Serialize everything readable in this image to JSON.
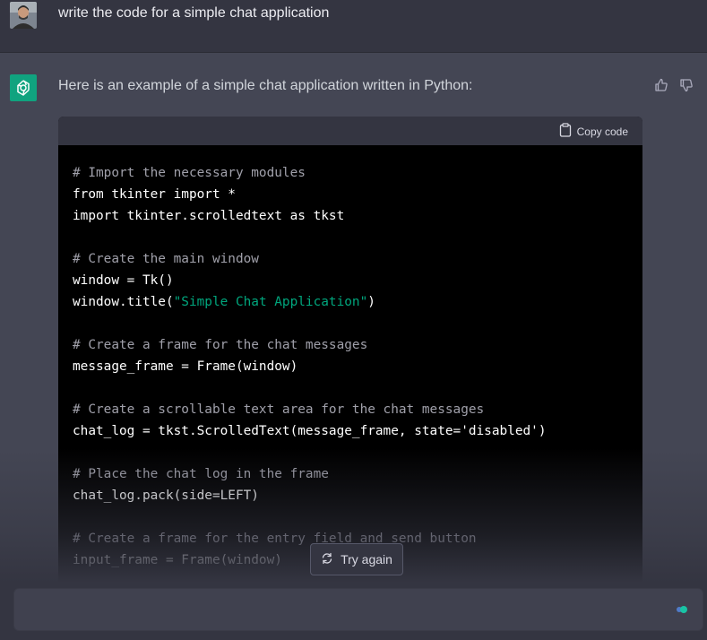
{
  "user": {
    "message": "write the code for a simple chat application",
    "avatar_icon": "user-avatar-photo"
  },
  "assistant": {
    "message": "Here is an example of a simple chat application written in Python:",
    "avatar_icon": "openai-logo-icon",
    "brand_color": "#10a37f",
    "thumbs_up_icon": "thumbs-up-icon",
    "thumbs_down_icon": "thumbs-down-icon"
  },
  "code_block": {
    "copy_label": "Copy code",
    "copy_icon": "clipboard-icon",
    "lines": [
      {
        "kind": "comment",
        "text": "# Import the necessary modules"
      },
      {
        "kind": "code",
        "text": "from tkinter import *"
      },
      {
        "kind": "code",
        "text": "import tkinter.scrolledtext as tkst"
      },
      {
        "kind": "blank",
        "text": ""
      },
      {
        "kind": "comment",
        "text": "# Create the main window"
      },
      {
        "kind": "code",
        "text": "window = Tk()"
      },
      {
        "kind": "mixed",
        "before": "window.title(",
        "string": "\"Simple Chat Application\"",
        "after": ")"
      },
      {
        "kind": "blank",
        "text": ""
      },
      {
        "kind": "comment",
        "text": "# Create a frame for the chat messages"
      },
      {
        "kind": "code",
        "text": "message_frame = Frame(window)"
      },
      {
        "kind": "blank",
        "text": ""
      },
      {
        "kind": "comment",
        "text": "# Create a scrollable text area for the chat messages"
      },
      {
        "kind": "code",
        "text": "chat_log = tkst.ScrolledText(message_frame, state='disabled')"
      },
      {
        "kind": "blank",
        "text": ""
      },
      {
        "kind": "comment",
        "text": "# Place the chat log in the frame"
      },
      {
        "kind": "code",
        "text": "chat_log.pack(side=LEFT)"
      },
      {
        "kind": "blank",
        "text": ""
      },
      {
        "kind": "comment",
        "text": "# Create a frame for the entry field and send button"
      },
      {
        "kind": "code",
        "text": "input_frame = Frame(window)"
      }
    ]
  },
  "try_again": {
    "label": "Try again",
    "icon": "refresh-icon"
  },
  "composer": {
    "value": "",
    "placeholder": "",
    "send_icon": "send-icon"
  }
}
